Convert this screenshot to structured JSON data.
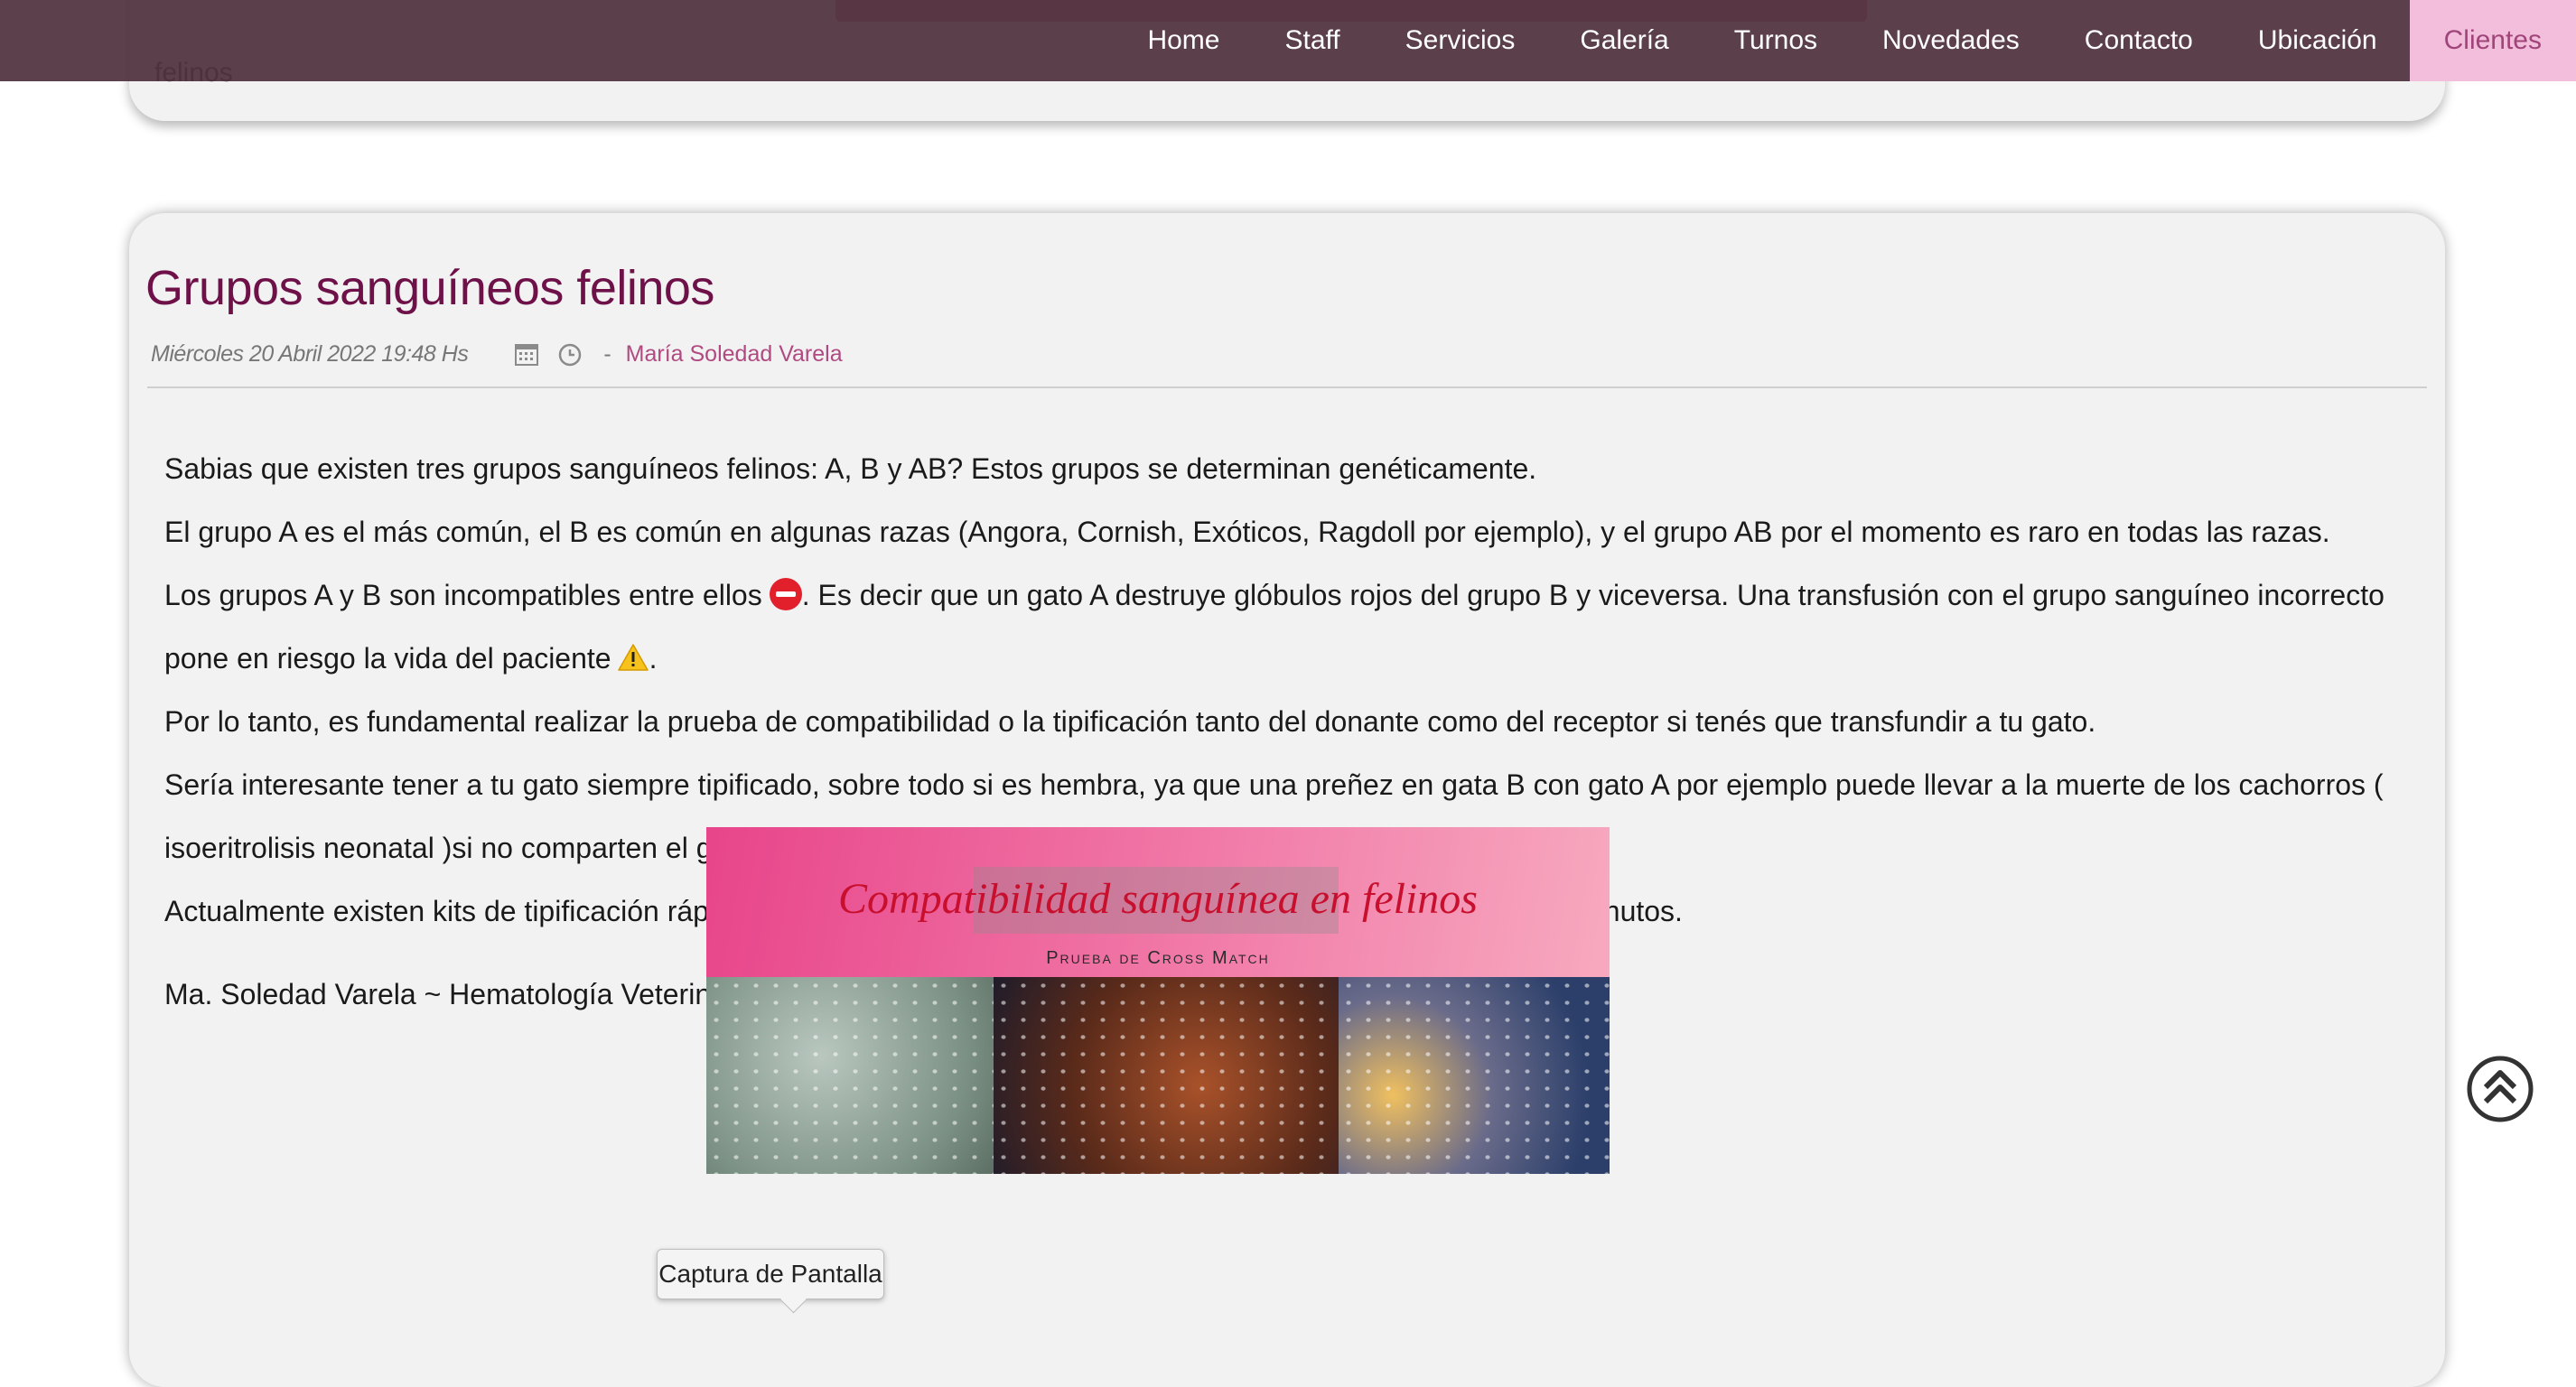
{
  "previous_post": {
    "tail_text": "felinos"
  },
  "nav": {
    "items": [
      "Home",
      "Staff",
      "Servicios",
      "Galería",
      "Turnos",
      "Novedades",
      "Contacto",
      "Ubicación"
    ],
    "active": "Clientes"
  },
  "post": {
    "title": "Grupos sanguíneos felinos",
    "date": "Miércoles 20 Abril 2022 19:48 Hs",
    "separator": "-",
    "author": "María Soledad Varela",
    "paragraphs": {
      "p1": "Sabias que existen tres grupos sanguíneos felinos: A, B y AB? Estos grupos se determinan genéticamente.",
      "p2": "El grupo A es el más común, el B es común en algunas razas (Angora, Cornish, Exóticos, Ragdoll por ejemplo), y el grupo AB por el momento es raro en todas las razas.",
      "p3a": "Los grupos A y B son incompatibles entre ellos",
      "p3b": ". Es decir que un gato A destruye glóbulos rojos del grupo B y viceversa. Una transfusión con el grupo sanguíneo incorrecto pone en riesgo la vida del paciente",
      "p3c": ".",
      "p4": "Por lo tanto, es fundamental realizar la prueba de compatibilidad o la tipificación tanto del donante como del receptor si tenés que transfundir a tu gato.",
      "p5": "Sería interesante tener a tu gato siempre tipificado, sobre todo si es hembra, ya que una preñez en gata B con gato A por ejemplo puede llevar a la muerte de los cachorros ( isoeritrolisis neonatal )si no comparten el grupo sanguíneo con su madre.",
      "p6": "Actualmente existen kits de tipificación rápida. Estos kits permiten conocer el grupo sanguíneo de tu gatito en minutos.",
      "p7": "Ma. Soledad Varela ~ Hematología Veterinaria"
    },
    "image": {
      "title": "Compatibilidad sanguínea en felinos",
      "subtitle": "Prueba de Cross Match"
    }
  },
  "tooltip": "Captura de Pantalla",
  "colors": {
    "navbar": "#50323e",
    "nav_active_bg": "#f2bedb",
    "title": "#6e1148",
    "author": "#b04a80"
  },
  "icons": [
    "calendar-icon",
    "clock-icon",
    "stop-emoji-icon",
    "warning-emoji-icon",
    "scroll-top-icon"
  ]
}
